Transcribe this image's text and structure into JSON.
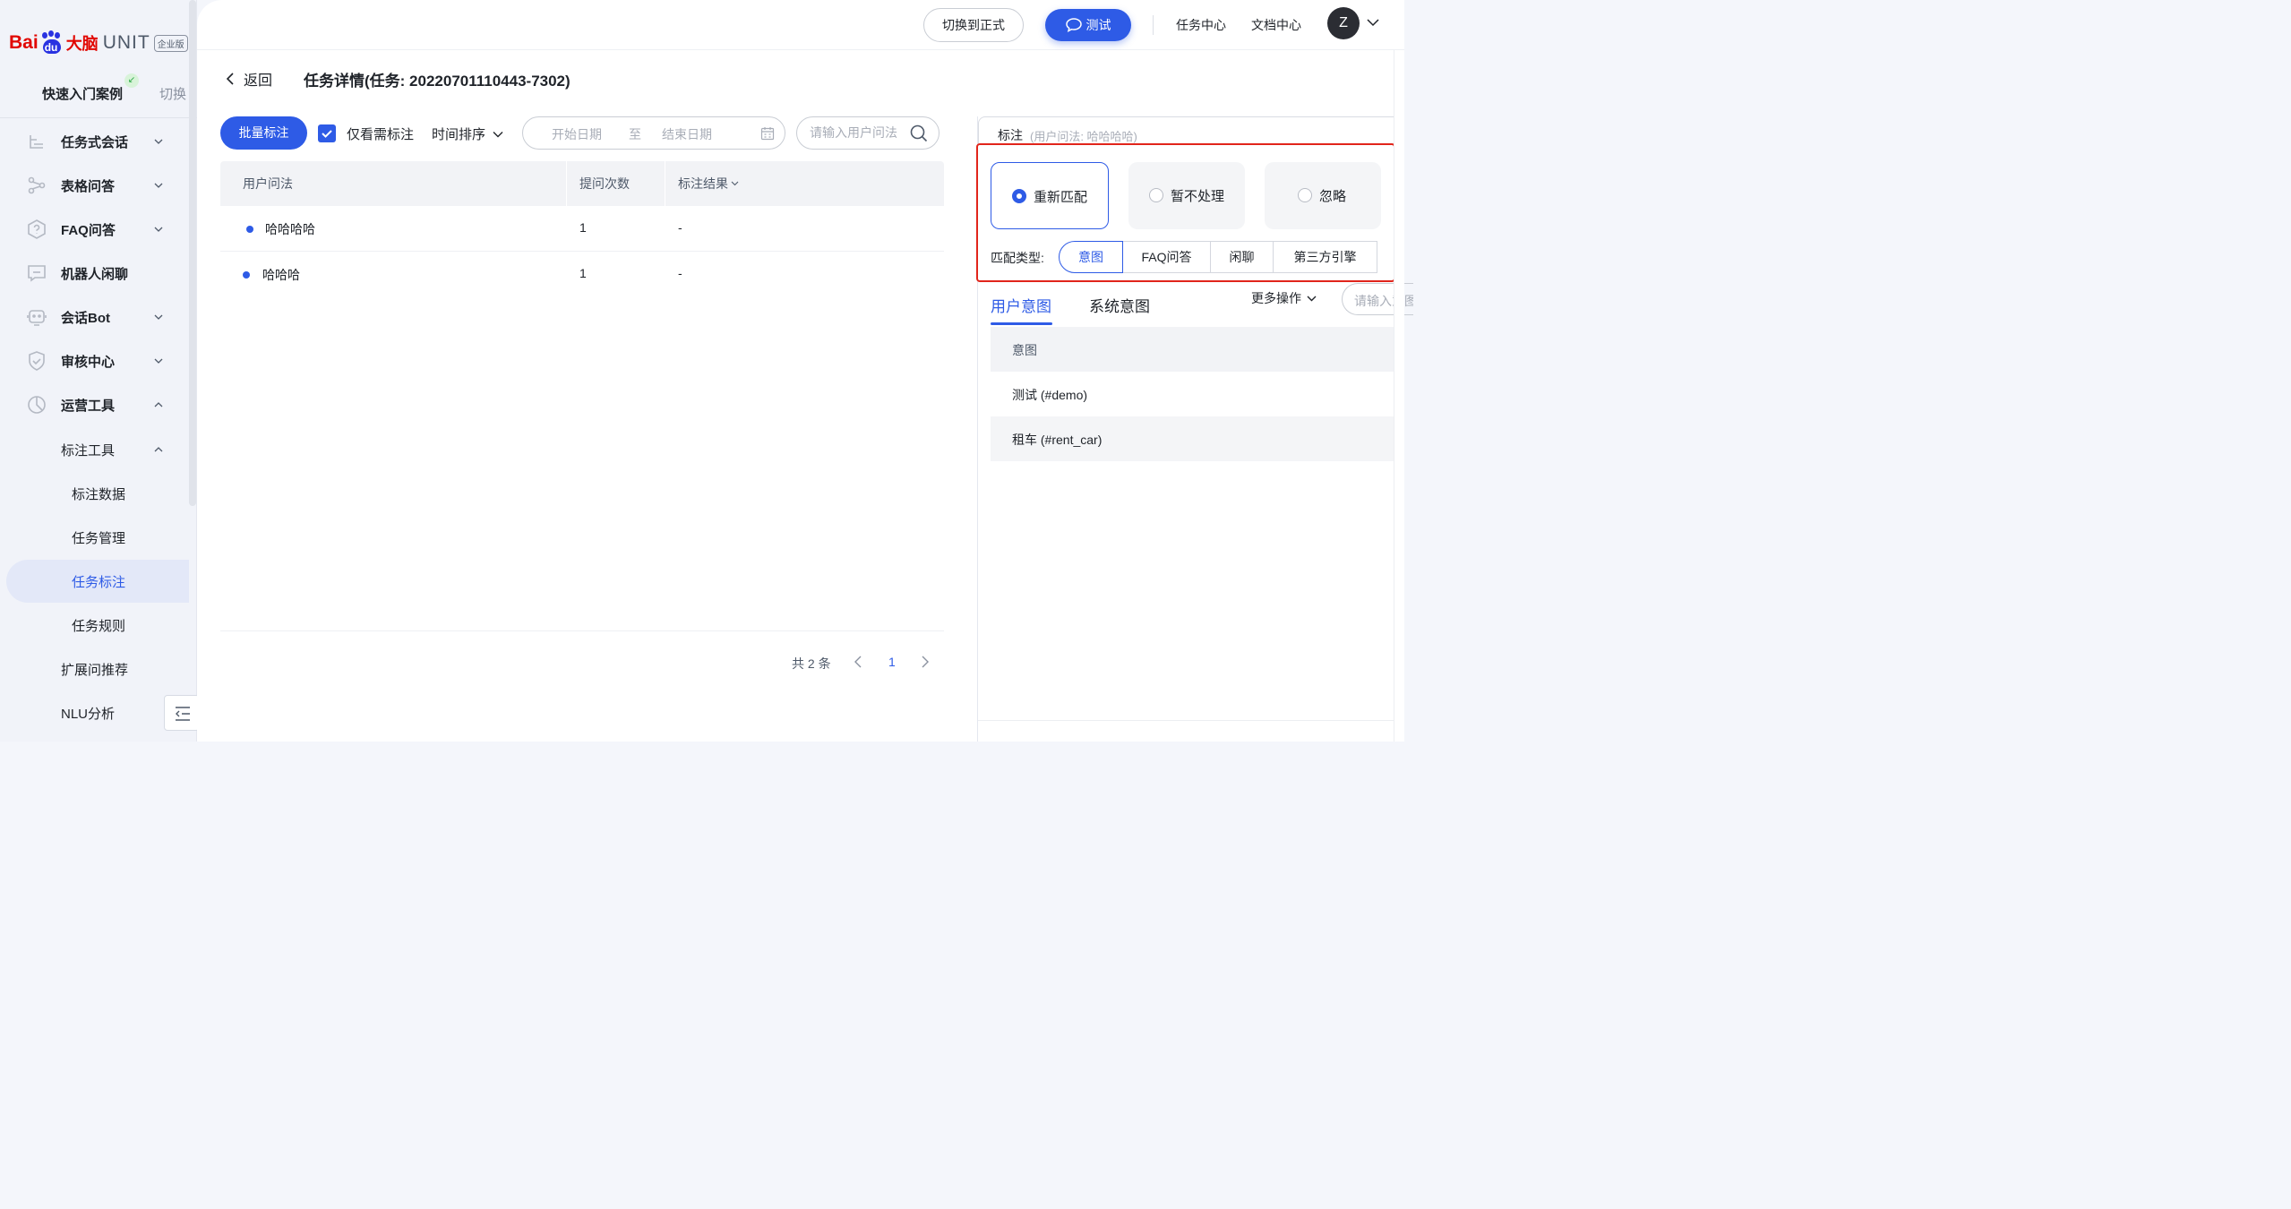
{
  "brand": {
    "logo_bai": "Bai",
    "logo_du": "du",
    "logo_danao": "大脑",
    "logo_unit": "UNIT",
    "enterprise_badge": "企业版"
  },
  "app": {
    "name": "快速入门案例",
    "switch_label": "切换"
  },
  "sidebar": {
    "items": [
      {
        "label": "任务式会话",
        "icon": "task-dialog-icon",
        "expanded": false
      },
      {
        "label": "表格问答",
        "icon": "table-qa-icon",
        "expanded": false
      },
      {
        "label": "FAQ问答",
        "icon": "faq-icon",
        "expanded": false
      },
      {
        "label": "机器人闲聊",
        "icon": "chat-icon"
      },
      {
        "label": "会话Bot",
        "icon": "bot-icon",
        "expanded": false
      },
      {
        "label": "审核中心",
        "icon": "shield-icon",
        "expanded": false
      },
      {
        "label": "运营工具",
        "icon": "ops-icon",
        "expanded": true
      }
    ],
    "sub_group": {
      "label": "标注工具",
      "expanded": true
    },
    "sub_items": [
      "标注数据",
      "任务管理",
      "任务标注",
      "任务规则"
    ],
    "active_sub": "任务标注",
    "more_items": [
      "扩展问推荐",
      "NLU分析"
    ]
  },
  "topbar": {
    "switch_formal": "切换到正式",
    "test": "测试",
    "task_center": "任务中心",
    "doc_center": "文档中心",
    "avatar_letter": "Z"
  },
  "page": {
    "back_label": "返回",
    "title": "任务详情(任务: 20220701110443-7302)"
  },
  "toolbar": {
    "batch_label": "批量标注",
    "only_need_label": "仅看需标注",
    "only_need_checked": true,
    "sort_label": "时间排序",
    "date_start_placeholder": "开始日期",
    "date_to": "至",
    "date_end_placeholder": "结束日期",
    "search_placeholder": "请输入用户问法"
  },
  "table": {
    "headers": {
      "query": "用户问法",
      "count": "提问次数",
      "result": "标注结果"
    },
    "rows": [
      {
        "query": "哈哈哈哈",
        "count": "1",
        "result": "-"
      },
      {
        "query": "哈哈哈",
        "count": "1",
        "result": "-"
      }
    ]
  },
  "pagination": {
    "total": "共 2 条",
    "current_page": "1"
  },
  "annotate": {
    "title": "标注",
    "subtitle": "(用户问法: 哈哈哈哈)",
    "options": [
      "重新匹配",
      "暂不处理",
      "忽略"
    ],
    "selected_option": "重新匹配",
    "match_type_label": "匹配类型:",
    "match_types": [
      "意图",
      "FAQ问答",
      "闲聊",
      "第三方引擎"
    ],
    "selected_match_type": "意图",
    "tabs": [
      "用户意图",
      "系统意图"
    ],
    "active_tab": "用户意图",
    "more_ops": "更多操作",
    "search_placeholder": "请输入意图",
    "intent_header": "意图",
    "intents": [
      "测试 (#demo)",
      "租车 (#rent_car)"
    ]
  },
  "colors": {
    "primary": "#2e5be6",
    "highlight_border": "#e1251b",
    "sidebar_bg": "#f1f3f9"
  }
}
